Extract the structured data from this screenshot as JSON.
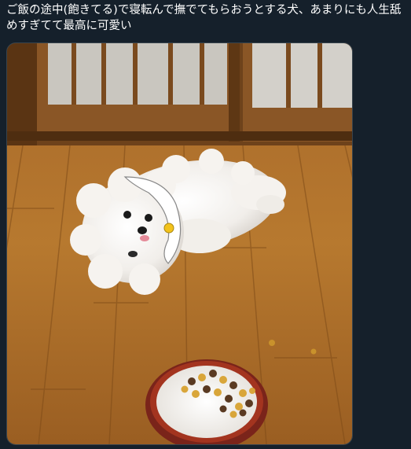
{
  "tweet": {
    "text": "ご飯の途中(飽きてる)で寝転んで撫でてもらおうとする犬、あまりにも人生舐めすぎてて最高に可愛い"
  },
  "media": {
    "type": "photo",
    "subject": "dog",
    "colors": {
      "background": "#15202b",
      "floor": "#b0742a",
      "door": "#7a4a1e",
      "fur": "#f3f0ec",
      "bowl_rim": "#8b2a1c"
    }
  }
}
